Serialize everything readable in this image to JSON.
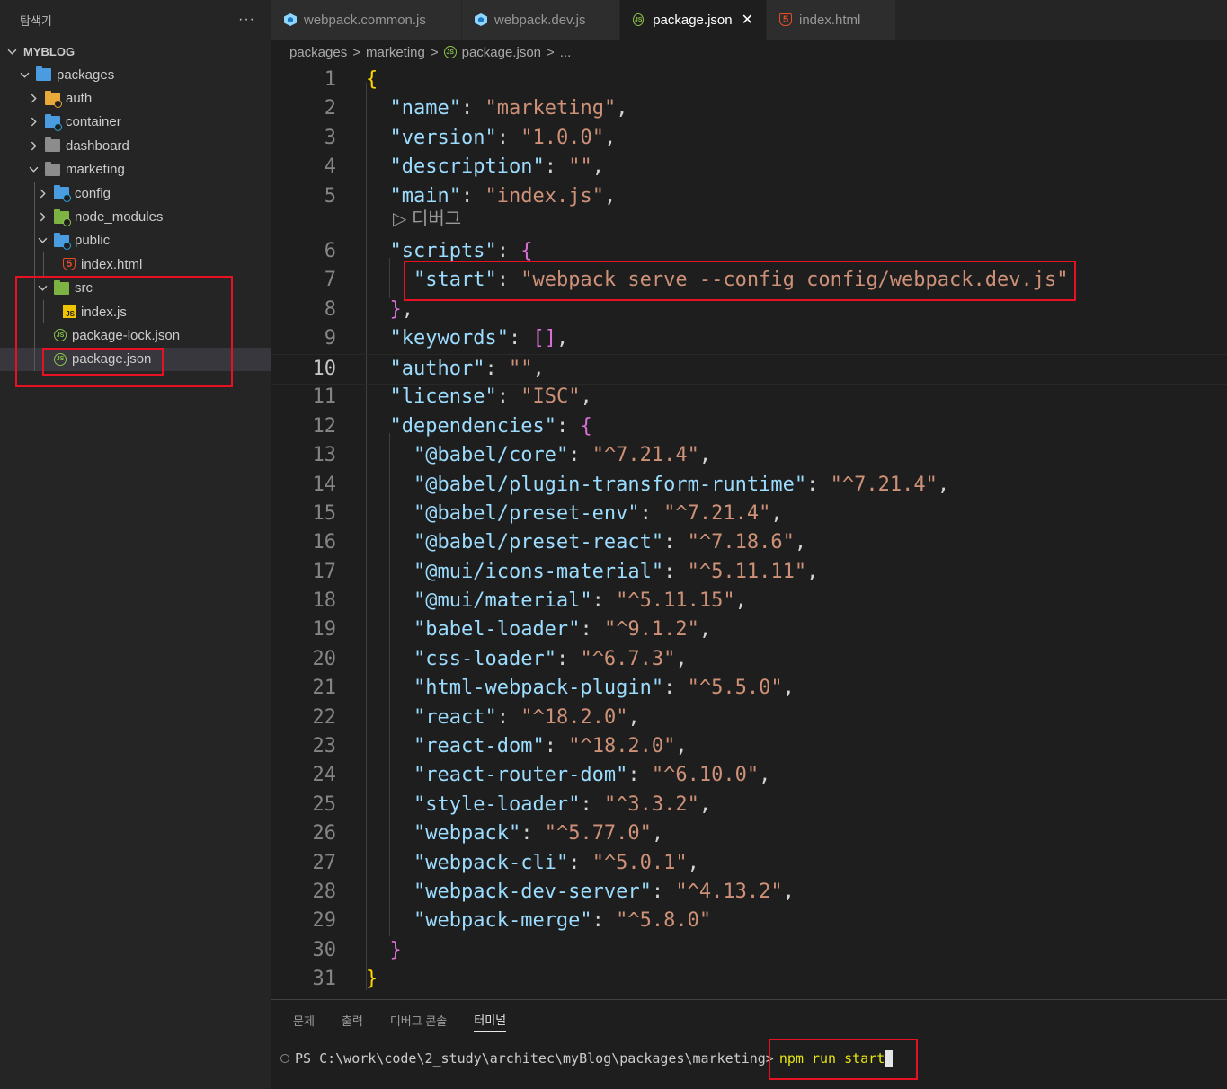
{
  "sidebar": {
    "title": "탐색기",
    "more": "···",
    "section": "MYBLOG",
    "items": [
      {
        "label": "packages",
        "icon": "folder-open-blue-icon"
      },
      {
        "label": "auth",
        "icon": "folder-yellow-icon"
      },
      {
        "label": "container",
        "icon": "folder-blue-icon"
      },
      {
        "label": "dashboard",
        "icon": "folder-icon"
      },
      {
        "label": "marketing",
        "icon": "folder-open-icon"
      },
      {
        "label": "config",
        "icon": "folder-config-icon"
      },
      {
        "label": "node_modules",
        "icon": "folder-node-icon"
      },
      {
        "label": "public",
        "icon": "folder-public-icon"
      },
      {
        "label": "index.html",
        "icon": "html-file-icon"
      },
      {
        "label": "src",
        "icon": "folder-src-icon"
      },
      {
        "label": "index.js",
        "icon": "js-file-icon"
      },
      {
        "label": "package-lock.json",
        "icon": "json-file-icon"
      },
      {
        "label": "package.json",
        "icon": "json-file-icon"
      }
    ]
  },
  "tabs": [
    {
      "label": "webpack.common.js",
      "icon": "webpack-icon"
    },
    {
      "label": "webpack.dev.js",
      "icon": "webpack-icon"
    },
    {
      "label": "package.json",
      "icon": "json-file-icon",
      "active": true,
      "close": "✕"
    },
    {
      "label": "index.html",
      "icon": "html-file-icon"
    }
  ],
  "breadcrumb": {
    "parts": [
      "packages",
      "marketing",
      "package.json",
      "..."
    ],
    "sep": ">"
  },
  "codelens": "▷ 디버그",
  "editor": {
    "current_line": 10,
    "lines": [
      {
        "n": "1"
      },
      {
        "n": "2"
      },
      {
        "n": "3"
      },
      {
        "n": "4"
      },
      {
        "n": "5"
      },
      {
        "n": "6"
      },
      {
        "n": "7"
      },
      {
        "n": "8"
      },
      {
        "n": "9"
      },
      {
        "n": "10"
      },
      {
        "n": "11"
      },
      {
        "n": "12"
      },
      {
        "n": "13"
      },
      {
        "n": "14"
      },
      {
        "n": "15"
      },
      {
        "n": "16"
      },
      {
        "n": "17"
      },
      {
        "n": "18"
      },
      {
        "n": "19"
      },
      {
        "n": "20"
      },
      {
        "n": "21"
      },
      {
        "n": "22"
      },
      {
        "n": "23"
      },
      {
        "n": "24"
      },
      {
        "n": "25"
      },
      {
        "n": "26"
      },
      {
        "n": "27"
      },
      {
        "n": "28"
      },
      {
        "n": "29"
      },
      {
        "n": "30"
      },
      {
        "n": "31"
      }
    ],
    "json": {
      "name": "marketing",
      "version": "1.0.0",
      "description": "",
      "main": "index.js",
      "scripts_key": "scripts",
      "start": "webpack serve --config config/webpack.dev.js",
      "keywords_key": "keywords",
      "author": "",
      "license": "ISC",
      "dependencies_key": "dependencies",
      "dependencies": [
        {
          "name": "@babel/core",
          "version": "^7.21.4"
        },
        {
          "name": "@babel/plugin-transform-runtime",
          "version": "^7.21.4"
        },
        {
          "name": "@babel/preset-env",
          "version": "^7.21.4"
        },
        {
          "name": "@babel/preset-react",
          "version": "^7.18.6"
        },
        {
          "name": "@mui/icons-material",
          "version": "^5.11.11"
        },
        {
          "name": "@mui/material",
          "version": "^5.11.15"
        },
        {
          "name": "babel-loader",
          "version": "^9.1.2"
        },
        {
          "name": "css-loader",
          "version": "^6.7.3"
        },
        {
          "name": "html-webpack-plugin",
          "version": "^5.5.0"
        },
        {
          "name": "react",
          "version": "^18.2.0"
        },
        {
          "name": "react-dom",
          "version": "^18.2.0"
        },
        {
          "name": "react-router-dom",
          "version": "^6.10.0"
        },
        {
          "name": "style-loader",
          "version": "^3.3.2"
        },
        {
          "name": "webpack",
          "version": "^5.77.0"
        },
        {
          "name": "webpack-cli",
          "version": "^5.0.1"
        },
        {
          "name": "webpack-dev-server",
          "version": "^4.13.2"
        },
        {
          "name": "webpack-merge",
          "version": "^5.8.0"
        }
      ]
    }
  },
  "panel": {
    "tabs": [
      "문제",
      "출력",
      "디버그 콘솔",
      "터미널"
    ],
    "active_tab": "터미널",
    "prompt": "PS C:\\work\\code\\2_study\\architec\\myBlog\\packages\\marketing>",
    "command": "npm run start"
  },
  "colors": {
    "annotation": "#e81123",
    "key": "#9cdcfe",
    "string": "#ce9178",
    "bracket": "#ffd700"
  }
}
